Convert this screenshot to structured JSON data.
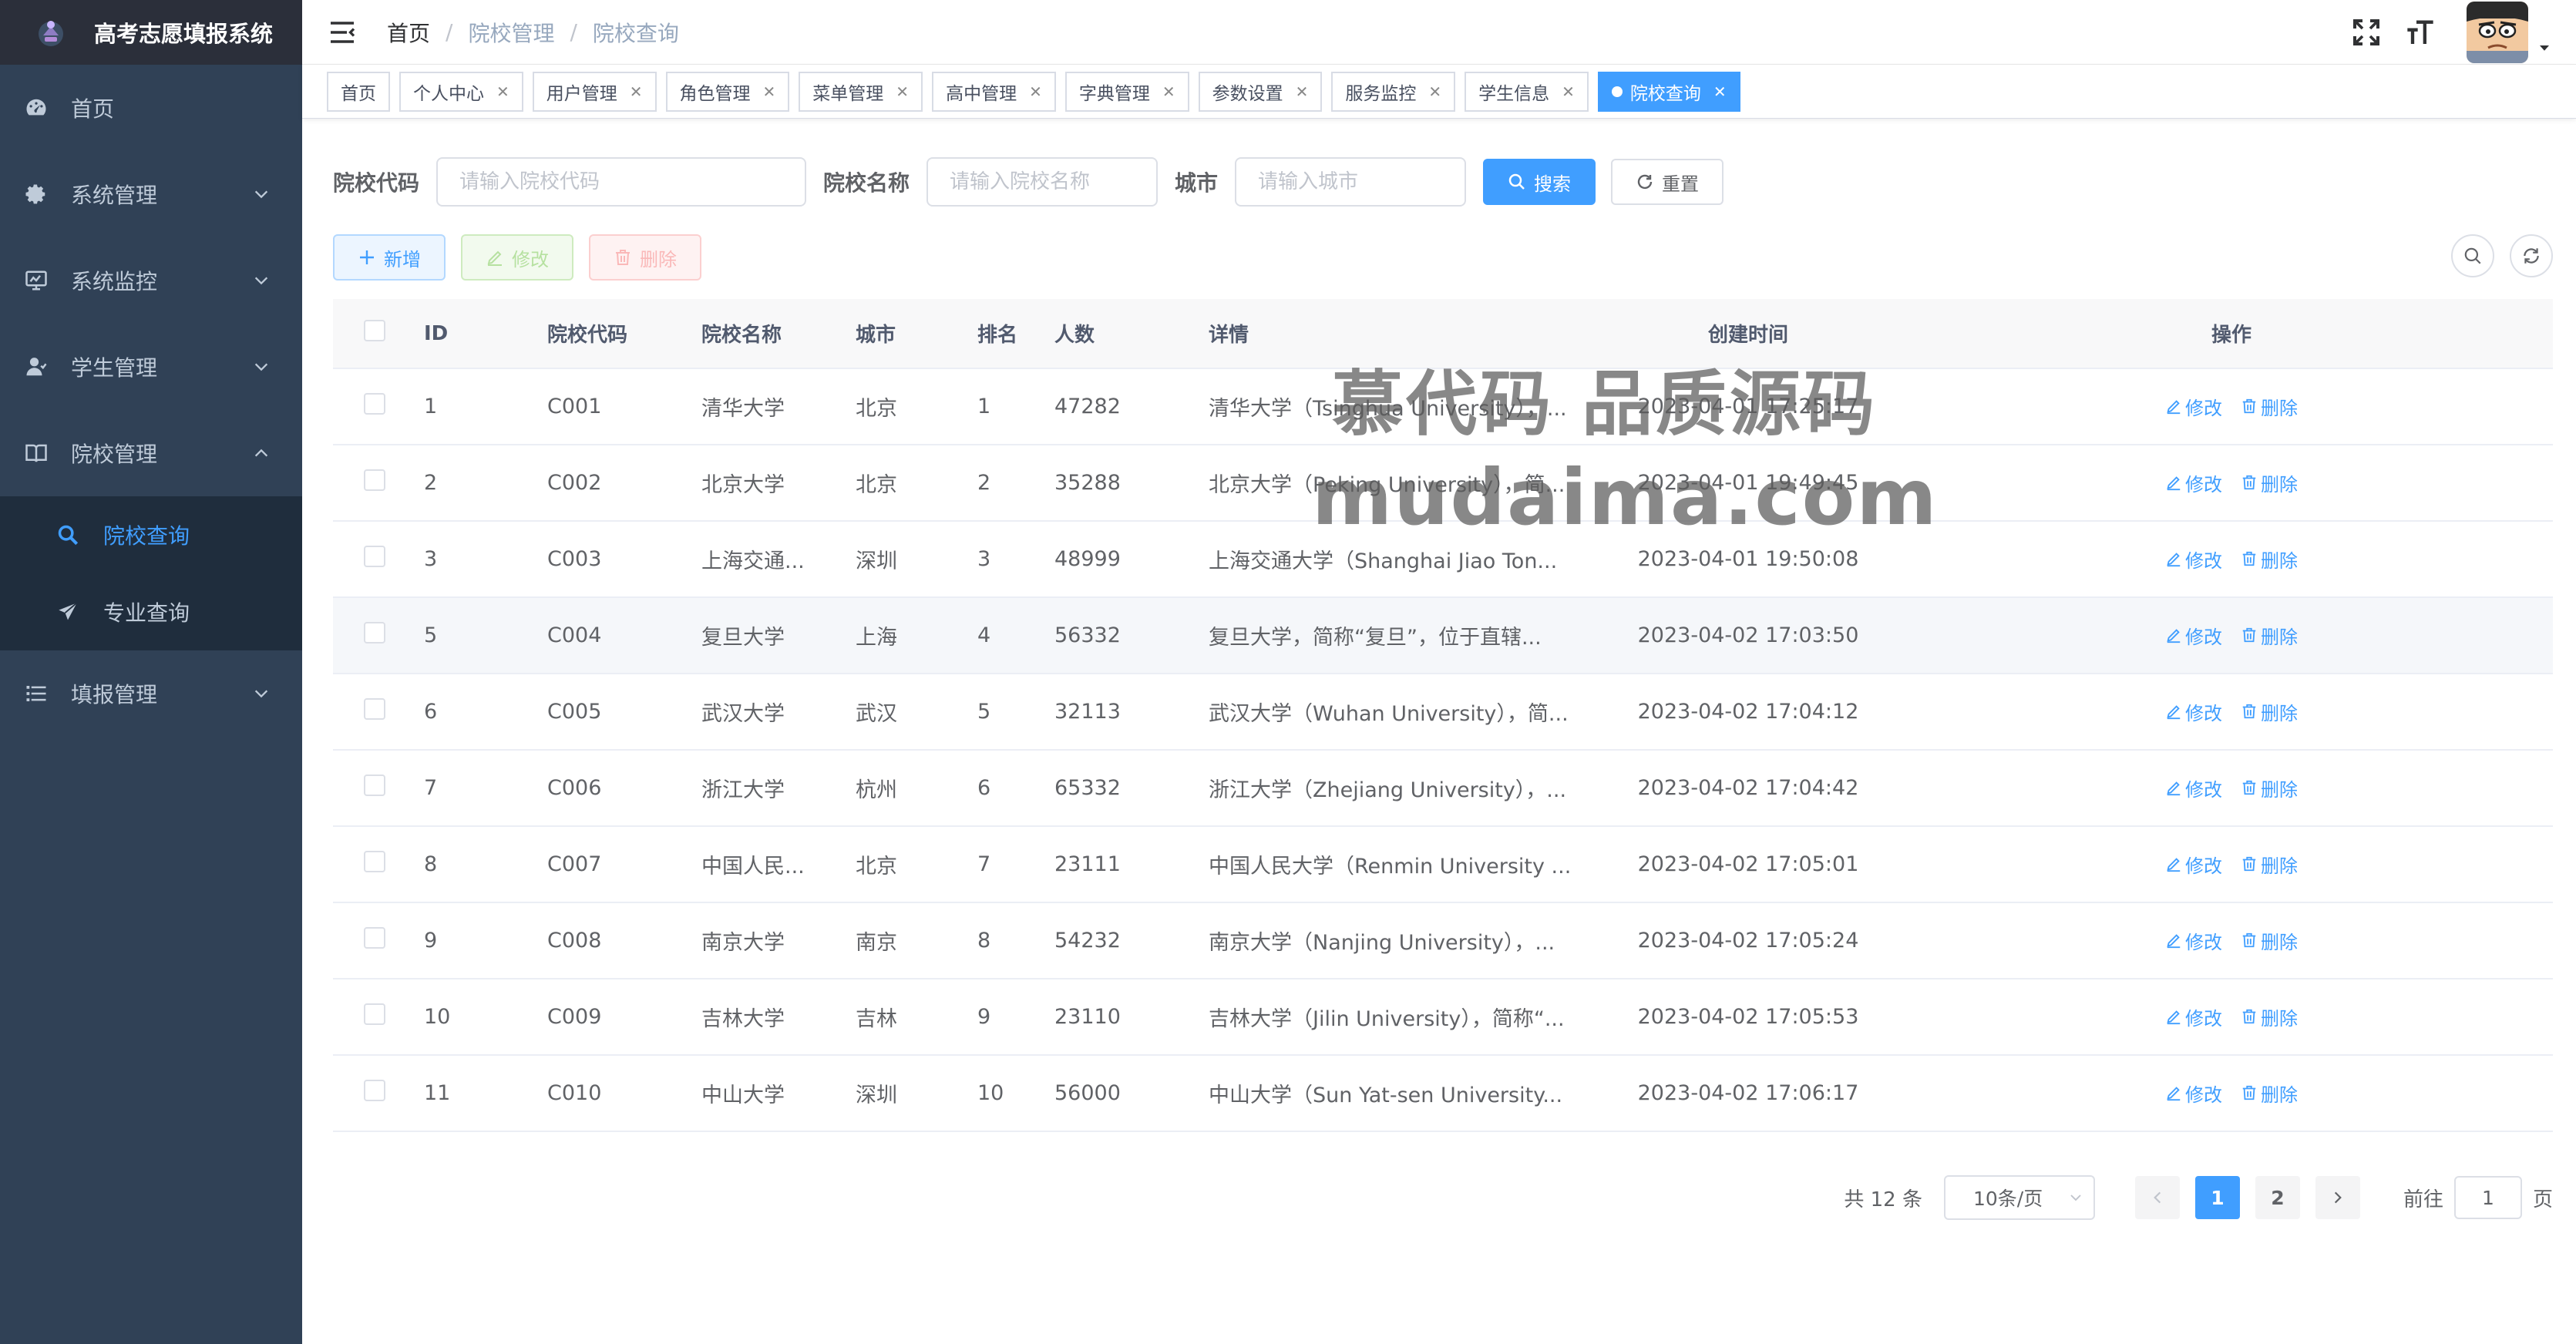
{
  "colors": {
    "sidebar_bg": "#304156",
    "sidebar_active": "#409eff",
    "primary": "#409eff",
    "tag_active": "#409eff"
  },
  "sidebar": {
    "title": "高考志愿填报系统",
    "items": [
      {
        "label": "首页",
        "icon": "dashboard-icon"
      },
      {
        "label": "系统管理",
        "icon": "gear-icon"
      },
      {
        "label": "系统监控",
        "icon": "monitor-icon"
      },
      {
        "label": "学生管理",
        "icon": "user-icon"
      },
      {
        "label": "院校管理",
        "icon": "book-icon"
      },
      {
        "label": "填报管理",
        "icon": "list-icon"
      }
    ],
    "sub_items": [
      {
        "label": "院校查询",
        "icon": "search-icon",
        "active": true
      },
      {
        "label": "专业查询",
        "icon": "send-icon",
        "active": false
      }
    ]
  },
  "navbar": {
    "breadcrumb": [
      "首页",
      "院校管理",
      "院校查询"
    ]
  },
  "tags": [
    {
      "label": "首页"
    },
    {
      "label": "个人中心"
    },
    {
      "label": "用户管理"
    },
    {
      "label": "角色管理"
    },
    {
      "label": "菜单管理"
    },
    {
      "label": "高中管理"
    },
    {
      "label": "字典管理"
    },
    {
      "label": "参数设置"
    },
    {
      "label": "服务监控"
    },
    {
      "label": "学生信息"
    },
    {
      "label": "院校查询",
      "active": true
    }
  ],
  "search": {
    "code_label": "院校代码",
    "code_placeholder": "请输入院校代码",
    "name_label": "院校名称",
    "name_placeholder": "请输入院校名称",
    "city_label": "城市",
    "city_placeholder": "请输入城市",
    "search_button": "搜索",
    "reset_button": "重置"
  },
  "toolbar": {
    "add": "新增",
    "edit": "修改",
    "delete": "删除"
  },
  "table": {
    "headers": [
      "ID",
      "院校代码",
      "院校名称",
      "城市",
      "排名",
      "人数",
      "详情",
      "创建时间",
      "操作"
    ],
    "edit_label": "修改",
    "delete_label": "删除",
    "rows": [
      {
        "id": "1",
        "code": "C001",
        "name": "清华大学",
        "city": "北京",
        "rank": "1",
        "count": "47282",
        "detail": "清华大学（Tsinghua University），...",
        "time": "2023-04-01 17:25:17"
      },
      {
        "id": "2",
        "code": "C002",
        "name": "北京大学",
        "city": "北京",
        "rank": "2",
        "count": "35288",
        "detail": "北京大学（Peking University），简...",
        "time": "2023-04-01 19:49:45"
      },
      {
        "id": "3",
        "code": "C003",
        "name": "上海交通...",
        "city": "深圳",
        "rank": "3",
        "count": "48999",
        "detail": "上海交通大学（Shanghai Jiao Ton...",
        "time": "2023-04-01 19:50:08"
      },
      {
        "id": "5",
        "code": "C004",
        "name": "复旦大学",
        "city": "上海",
        "rank": "4",
        "count": "56332",
        "detail": "复旦大学，简称“复旦”，位于直辖...",
        "time": "2023-04-02 17:03:50"
      },
      {
        "id": "6",
        "code": "C005",
        "name": "武汉大学",
        "city": "武汉",
        "rank": "5",
        "count": "32113",
        "detail": "武汉大学（Wuhan University），简...",
        "time": "2023-04-02 17:04:12"
      },
      {
        "id": "7",
        "code": "C006",
        "name": "浙江大学",
        "city": "杭州",
        "rank": "6",
        "count": "65332",
        "detail": "浙江大学（Zhejiang University），...",
        "time": "2023-04-02 17:04:42"
      },
      {
        "id": "8",
        "code": "C007",
        "name": "中国人民...",
        "city": "北京",
        "rank": "7",
        "count": "23111",
        "detail": "中国人民大学（Renmin University ...",
        "time": "2023-04-02 17:05:01"
      },
      {
        "id": "9",
        "code": "C008",
        "name": "南京大学",
        "city": "南京",
        "rank": "8",
        "count": "54232",
        "detail": "南京大学（Nanjing University），...",
        "time": "2023-04-02 17:05:24"
      },
      {
        "id": "10",
        "code": "C009",
        "name": "吉林大学",
        "city": "吉林",
        "rank": "9",
        "count": "23110",
        "detail": "吉林大学（Jilin University），简称“...",
        "time": "2023-04-02 17:05:53"
      },
      {
        "id": "11",
        "code": "C010",
        "name": "中山大学",
        "city": "深圳",
        "rank": "10",
        "count": "56000",
        "detail": "中山大学（Sun Yat-sen University...",
        "time": "2023-04-02 17:06:17"
      }
    ]
  },
  "pagination": {
    "total": "共 12 条",
    "page_size": "10条/页",
    "pages": [
      "1",
      "2"
    ],
    "current": "1",
    "goto_label": "前往",
    "goto_value": "1",
    "page_suffix": "页"
  },
  "watermark": {
    "line1": "慕代码 品质源码",
    "line2": "mudaima.com"
  }
}
